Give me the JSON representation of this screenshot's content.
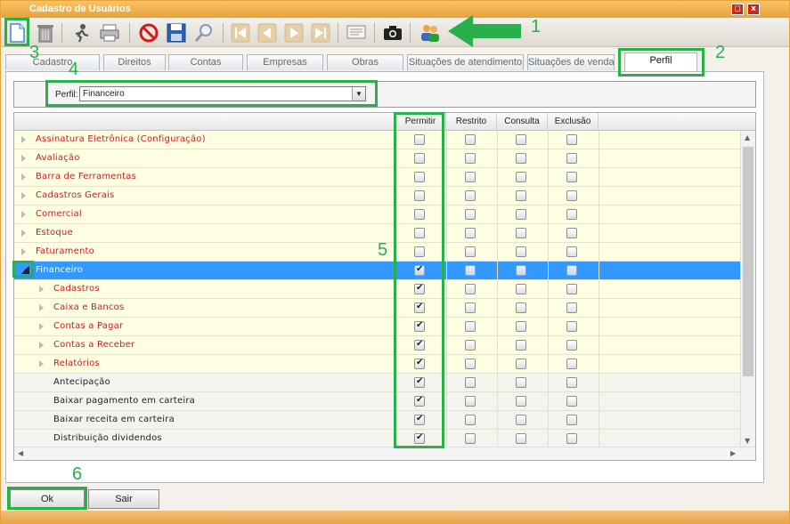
{
  "window": {
    "title": "Cadastro de Usuários",
    "minimize_glyph": "◻",
    "close_glyph": "x"
  },
  "toolbar": {
    "buttons": [
      {
        "name": "new-document-icon",
        "icon": "new"
      },
      {
        "name": "trash-icon",
        "icon": "trash"
      },
      {
        "name": "edit-runner-icon",
        "icon": "runner"
      },
      {
        "name": "printer-icon",
        "icon": "printer"
      },
      {
        "name": "cancel-icon",
        "icon": "cancel"
      },
      {
        "name": "save-icon",
        "icon": "save"
      },
      {
        "name": "search-icon",
        "icon": "search"
      },
      {
        "name": "first-record-icon",
        "icon": "first"
      },
      {
        "name": "previous-record-icon",
        "icon": "prev"
      },
      {
        "name": "next-record-icon",
        "icon": "next"
      },
      {
        "name": "last-record-icon",
        "icon": "last"
      },
      {
        "name": "report-icon",
        "icon": "report"
      },
      {
        "name": "camera-icon",
        "icon": "camera"
      },
      {
        "name": "users-icon",
        "icon": "users"
      }
    ]
  },
  "tabs": [
    {
      "label": "Cadastro",
      "active": false
    },
    {
      "label": "Direitos",
      "active": false
    },
    {
      "label": "Contas",
      "active": false
    },
    {
      "label": "Empresas",
      "active": false
    },
    {
      "label": "Obras",
      "active": false
    },
    {
      "label": "Situações de atendimento",
      "active": false
    },
    {
      "label": "Situações de venda",
      "active": false
    },
    {
      "label": "Perfil",
      "active": true
    }
  ],
  "perfil": {
    "label": "Perfil:",
    "value": "Financeiro",
    "dropdown_glyph": "▼"
  },
  "grid": {
    "columns": [
      "Permitir",
      "Restrito",
      "Consulta",
      "Exclusão"
    ],
    "rows": [
      {
        "label": "Assinatura Eletrônica (Configuração)",
        "level": 0,
        "style": "yellow",
        "text": "red",
        "expander": "closed",
        "checks": [
          false,
          false,
          false,
          false
        ]
      },
      {
        "label": "Avaliação",
        "level": 0,
        "style": "yellow",
        "text": "red",
        "expander": "closed",
        "checks": [
          false,
          false,
          false,
          false
        ]
      },
      {
        "label": "Barra de Ferramentas",
        "level": 0,
        "style": "yellow",
        "text": "red",
        "expander": "closed",
        "checks": [
          false,
          false,
          false,
          false
        ]
      },
      {
        "label": "Cadastros Gerais",
        "level": 0,
        "style": "yellow",
        "text": "red",
        "expander": "closed",
        "checks": [
          false,
          false,
          false,
          false
        ]
      },
      {
        "label": "Comercial",
        "level": 0,
        "style": "yellow",
        "text": "red",
        "expander": "closed",
        "checks": [
          false,
          false,
          false,
          false
        ]
      },
      {
        "label": "Estoque",
        "level": 0,
        "style": "yellow",
        "text": "red",
        "expander": "closed",
        "checks": [
          false,
          false,
          false,
          false
        ]
      },
      {
        "label": "Faturamento",
        "level": 0,
        "style": "yellow",
        "text": "red",
        "expander": "closed",
        "checks": [
          false,
          false,
          false,
          false
        ]
      },
      {
        "label": "Financeiro",
        "level": 0,
        "style": "selected",
        "text": "white",
        "expander": "open",
        "checks": [
          true,
          false,
          false,
          false
        ]
      },
      {
        "label": "Cadastros",
        "level": 1,
        "style": "yellow",
        "text": "red",
        "expander": "closed",
        "checks": [
          true,
          false,
          false,
          false
        ]
      },
      {
        "label": "Caixa e Bancos",
        "level": 1,
        "style": "yellow",
        "text": "red",
        "expander": "closed",
        "checks": [
          true,
          false,
          false,
          false
        ]
      },
      {
        "label": "Contas a Pagar",
        "level": 1,
        "style": "yellow",
        "text": "red",
        "expander": "closed",
        "checks": [
          true,
          false,
          false,
          false
        ]
      },
      {
        "label": "Contas a Receber",
        "level": 1,
        "style": "yellow",
        "text": "red",
        "expander": "closed",
        "checks": [
          true,
          false,
          false,
          false
        ]
      },
      {
        "label": "Relatórios",
        "level": 1,
        "style": "yellow",
        "text": "red",
        "expander": "closed",
        "checks": [
          true,
          false,
          false,
          false
        ]
      },
      {
        "label": "Antecipação",
        "level": 1,
        "style": "gray",
        "text": "dark",
        "expander": "none",
        "checks": [
          true,
          false,
          false,
          false
        ]
      },
      {
        "label": "Baixar pagamento em carteira",
        "level": 1,
        "style": "gray",
        "text": "dark",
        "expander": "none",
        "checks": [
          true,
          false,
          false,
          false
        ]
      },
      {
        "label": "Baixar receita em carteira",
        "level": 1,
        "style": "gray",
        "text": "dark",
        "expander": "none",
        "checks": [
          true,
          false,
          false,
          false
        ]
      },
      {
        "label": "Distribuição dividendos",
        "level": 1,
        "style": "gray",
        "text": "dark",
        "expander": "none",
        "checks": [
          true,
          false,
          false,
          false
        ]
      }
    ]
  },
  "buttons": {
    "ok": "Ok",
    "sair": "Sair"
  },
  "annotations": [
    "1",
    "2",
    "3",
    "4",
    "5",
    "6"
  ],
  "colors": {
    "accent_orange": "#e9a037",
    "annotation_green": "#28b14a",
    "selection_blue": "#3399ff",
    "red_text": "#cc1e1e"
  }
}
